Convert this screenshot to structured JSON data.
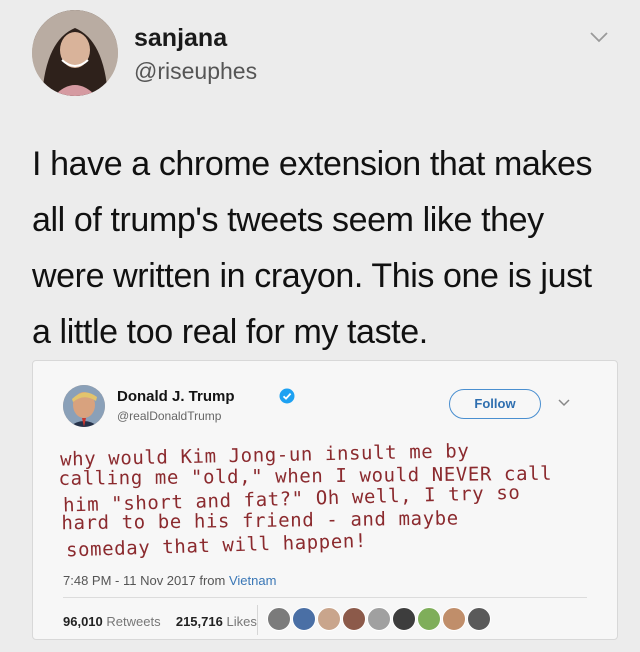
{
  "outer_tweet": {
    "name": "sanjana",
    "handle": "@riseuphes",
    "text": "I have a chrome extension that makes all of trump's tweets seem like they were written in crayon. This one is just a little too real for my taste."
  },
  "embedded_tweet": {
    "name": "Donald J. Trump",
    "handle": "@realDonaldTrump",
    "follow_label": "Follow",
    "crayon_lines": [
      "why would Kim Jong-un insult me by",
      "calling me \"old,\" when I would NEVER call",
      "him \"short and fat?\" Oh well, I try so",
      "hard to be his friend - and maybe",
      "someday that will happen!"
    ],
    "timestamp": "7:48 PM - 11 Nov 2017",
    "timestamp_from": "from",
    "source": "Vietnam",
    "retweets_count": "96,010",
    "retweets_label": "Retweets",
    "likes_count": "215,716",
    "likes_label": "Likes",
    "liker_avatar_colors": [
      "#7b7b7b",
      "#4a6fa5",
      "#c9a58c",
      "#8c5a4a",
      "#a0a0a0",
      "#3d3d3d",
      "#7fae5a",
      "#c08e6a",
      "#5a5a5a"
    ]
  },
  "colors": {
    "crayon": "#8b2a2e",
    "link_blue": "#3a77b6",
    "follow_blue": "#2f6fb0",
    "verified_blue": "#1da1f2"
  }
}
